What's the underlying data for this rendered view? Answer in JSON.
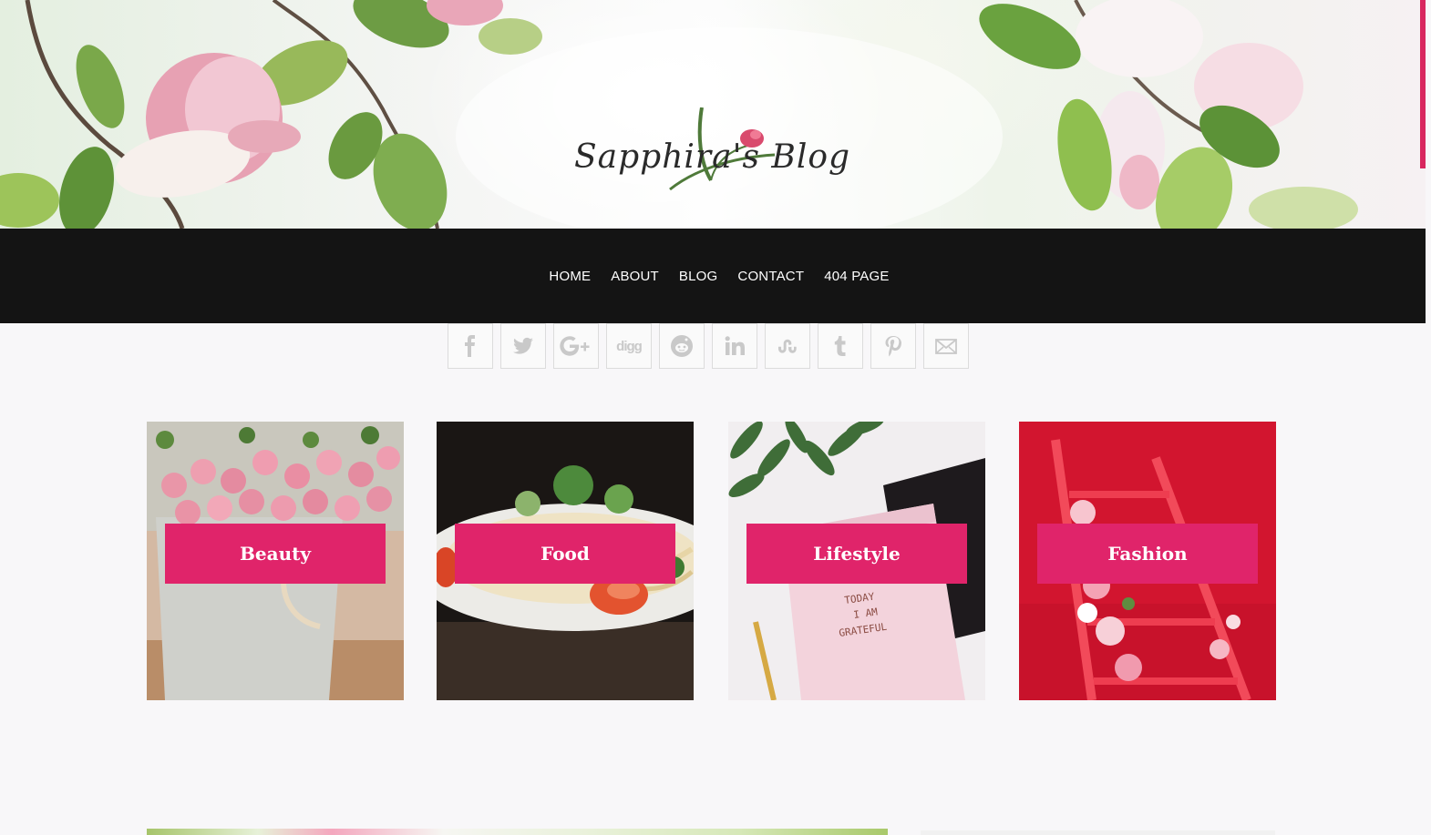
{
  "header": {
    "logo_text": "Sapphira's Blog",
    "accent_color": "#e0246a"
  },
  "nav": {
    "items": [
      {
        "label": "HOME"
      },
      {
        "label": "ABOUT"
      },
      {
        "label": "BLOG"
      },
      {
        "label": "CONTACT"
      },
      {
        "label": "404 PAGE"
      }
    ],
    "background": "#141414"
  },
  "share": {
    "buttons": [
      {
        "icon": "facebook-icon"
      },
      {
        "icon": "twitter-icon"
      },
      {
        "icon": "google-plus-icon"
      },
      {
        "icon": "digg-icon",
        "text": "digg"
      },
      {
        "icon": "reddit-icon"
      },
      {
        "icon": "linkedin-icon"
      },
      {
        "icon": "stumbleupon-icon"
      },
      {
        "icon": "tumblr-icon"
      },
      {
        "icon": "pinterest-icon"
      },
      {
        "icon": "email-icon"
      }
    ]
  },
  "categories": [
    {
      "label": "Beauty"
    },
    {
      "label": "Food"
    },
    {
      "label": "Lifestyle"
    },
    {
      "label": "Fashion"
    }
  ]
}
